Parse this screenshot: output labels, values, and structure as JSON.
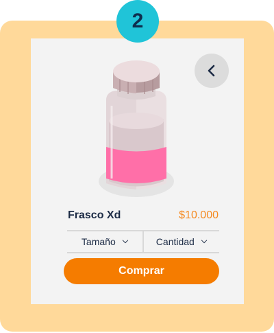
{
  "step": {
    "number": "2"
  },
  "product": {
    "name": "Frasco Xd",
    "price": "$10.000",
    "image_icon": "bottle-icon"
  },
  "selectors": {
    "size_label": "Tamaño",
    "quantity_label": "Cantidad"
  },
  "actions": {
    "buy_label": "Comprar",
    "back_icon": "chevron-left-icon"
  },
  "colors": {
    "outer_background": "#ffd99a",
    "badge": "#20c4d8",
    "accent": "#f57c00",
    "price": "#f5891f",
    "text": "#1c2b45",
    "label_band": "#ff6fa8"
  }
}
